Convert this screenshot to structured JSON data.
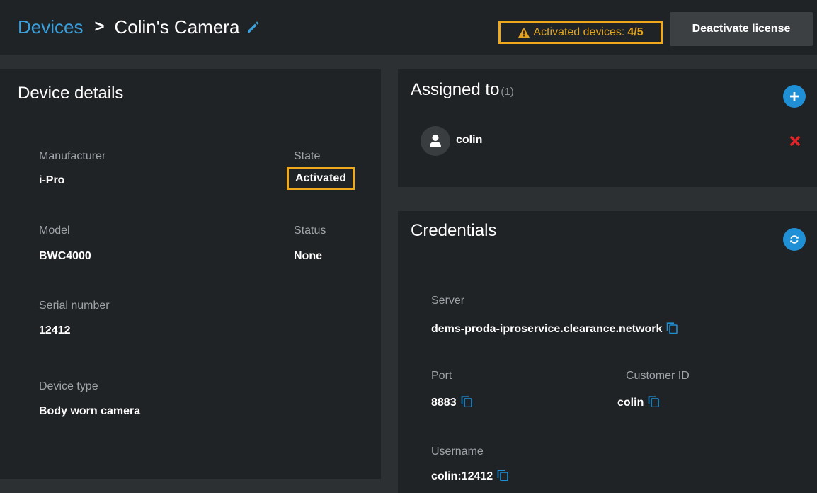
{
  "header": {
    "breadcrumb_root": "Devices",
    "breadcrumb_separator": ">",
    "device_name": "Colin's Camera",
    "activated_label": "Activated devices:",
    "activated_count": "4/5",
    "deactivate_label": "Deactivate license"
  },
  "device_details": {
    "title": "Device details",
    "manufacturer_label": "Manufacturer",
    "manufacturer": "i-Pro",
    "state_label": "State",
    "state": "Activated",
    "model_label": "Model",
    "model": "BWC4000",
    "status_label": "Status",
    "status": "None",
    "serial_label": "Serial number",
    "serial": "12412",
    "type_label": "Device type",
    "type": "Body worn camera"
  },
  "assigned": {
    "title": "Assigned to",
    "count": "(1)",
    "users": [
      {
        "name": "colin"
      }
    ]
  },
  "credentials": {
    "title": "Credentials",
    "server_label": "Server",
    "server": "dems-proda-iproservice.clearance.network",
    "port_label": "Port",
    "port": "8883",
    "customer_label": "Customer ID",
    "customer": "colin",
    "username_label": "Username",
    "username": "colin:12412"
  },
  "colors": {
    "accent": "#1f8fd6",
    "link": "#3aa0dc",
    "highlight": "#f0a81c",
    "danger": "#e0242a",
    "panel": "#202326",
    "background": "#2d3033"
  },
  "icons": {
    "edit": "pencil-icon",
    "warning": "warning-icon",
    "add": "plus-icon",
    "refresh": "refresh-icon",
    "user": "user-icon",
    "remove": "close-icon",
    "copy": "copy-icon"
  }
}
